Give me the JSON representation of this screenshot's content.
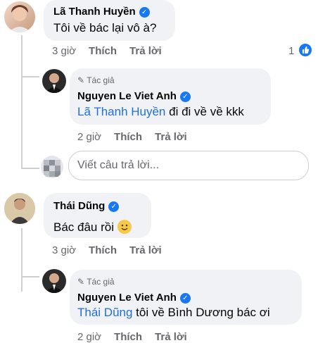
{
  "comments": [
    {
      "author": "Lã Thanh Huyền",
      "text": "Tôi về bác lại vô à?",
      "time": "3 giờ",
      "like_label": "Thích",
      "reply_label": "Trả lời",
      "reactions_count": "1"
    },
    {
      "author_tag": "Tác giả",
      "author": "Nguyen Le Viet Anh",
      "mention": "Lã Thanh Huyền",
      "text": " đi đi về về kkk",
      "time": "2 giờ",
      "like_label": "Thích",
      "reply_label": "Trả lời"
    },
    {
      "author": "Thái Dũng",
      "text": "Bác đâu rồi ",
      "emoji": "🙂",
      "time": "3 giờ",
      "like_label": "Thích",
      "reply_label": "Trả lời"
    },
    {
      "author_tag": "Tác giả",
      "author": "Nguyen Le Viet Anh",
      "mention": "Thái Dũng",
      "text": " tôi về Bình Dương bác ơi",
      "time": "2 giờ",
      "like_label": "Thích",
      "reply_label": "Trả lời"
    }
  ],
  "reply_box": {
    "placeholder": "Viết câu trả lời..."
  },
  "colors": {
    "link": "#216fdb",
    "bubble": "#f0f2f5",
    "meta": "#65676b",
    "verified": "#1877f2"
  }
}
